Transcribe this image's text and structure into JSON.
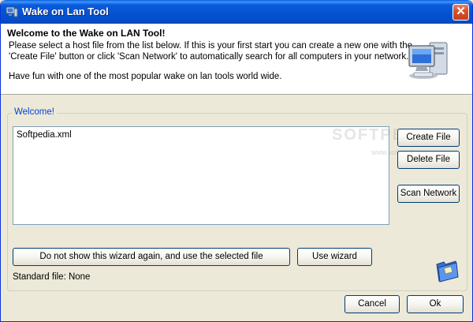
{
  "window": {
    "title": "Wake on Lan Tool",
    "close_glyph": "✕"
  },
  "header": {
    "title": "Welcome to the Wake on LAN Tool!",
    "line1": "Please select a host file from the list below. If this is your first start you can create a new one with the",
    "line2": "'Create File' button or click 'Scan Network' to automatically search for all computers in your network.",
    "line3": "Have fun with one of the most popular wake on lan tools world wide."
  },
  "group": {
    "label": "Welcome!"
  },
  "host_list": {
    "items": [
      "Softpedia.xml"
    ]
  },
  "buttons": {
    "create_file": "Create File",
    "delete_file": "Delete File",
    "scan_network": "Scan Network",
    "dont_show": "Do not show this wizard again, and use the selected file",
    "use_wizard": "Use wizard",
    "cancel": "Cancel",
    "ok": "Ok"
  },
  "status": {
    "standard_file": "Standard file: None"
  },
  "watermark": {
    "text": "SOFTPEDIA",
    "sub": "www.softpedia.com"
  },
  "icons": {
    "app": "network-computer-icon",
    "header": "computer-icon",
    "folder": "folder-icon"
  }
}
